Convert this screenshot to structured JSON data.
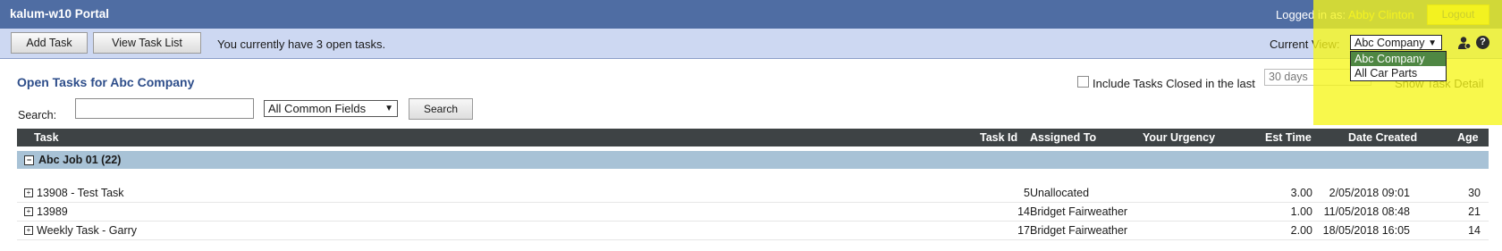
{
  "header": {
    "title": "kalum-w10 Portal",
    "logged_in_prefix": "Logged in as:",
    "user_name": "Abby Clinton",
    "logout_label": "Logout"
  },
  "toolbar": {
    "add_task_label": "Add Task",
    "view_task_list_label": "View Task List",
    "open_tasks_message": "You currently have 3 open tasks.",
    "current_view_label": "Current View:",
    "current_view_value": "Abc Company",
    "current_view_options": [
      "Abc Company",
      "All Car Parts"
    ]
  },
  "filters": {
    "page_title": "Open Tasks for Abc Company",
    "include_closed_label": "Include Tasks Closed in the last",
    "include_closed_checked": false,
    "days_value": "30 days",
    "show_task_detail_label": "Show Task Detail",
    "search_label": "Search:",
    "search_value": "",
    "field_select_value": "All Common Fields",
    "search_button_label": "Search"
  },
  "table": {
    "columns": {
      "task": "Task",
      "task_id": "Task Id",
      "assigned_to": "Assigned To",
      "urgency": "Your Urgency",
      "est_time": "Est Time",
      "date_created": "Date Created",
      "age": "Age"
    },
    "group": {
      "label": "Abc Job 01 (22)"
    },
    "rows": [
      {
        "task": "13908 - Test Task",
        "task_id": "5",
        "assigned_to": "Unallocated",
        "urgency": "",
        "est_time": "3.00",
        "date_created": "2/05/2018 09:01",
        "age": "30"
      },
      {
        "task": "13989",
        "task_id": "14",
        "assigned_to": "Bridget Fairweather",
        "urgency": "",
        "est_time": "1.00",
        "date_created": "11/05/2018 08:48",
        "age": "21"
      },
      {
        "task": "Weekly Task - Garry",
        "task_id": "17",
        "assigned_to": "Bridget Fairweather",
        "urgency": "",
        "est_time": "2.00",
        "date_created": "18/05/2018 16:05",
        "age": "14"
      }
    ]
  },
  "colors": {
    "header_bg": "#4f6da3",
    "toolbar_bg": "#cdd8f2",
    "highlight": "#f6f61a",
    "table_header_bg": "#3e4345",
    "group_row_bg": "#a8c2d6",
    "selected_option_bg": "#4f8743"
  },
  "icons": {
    "role": "user-role-icon",
    "help": "help-icon"
  }
}
